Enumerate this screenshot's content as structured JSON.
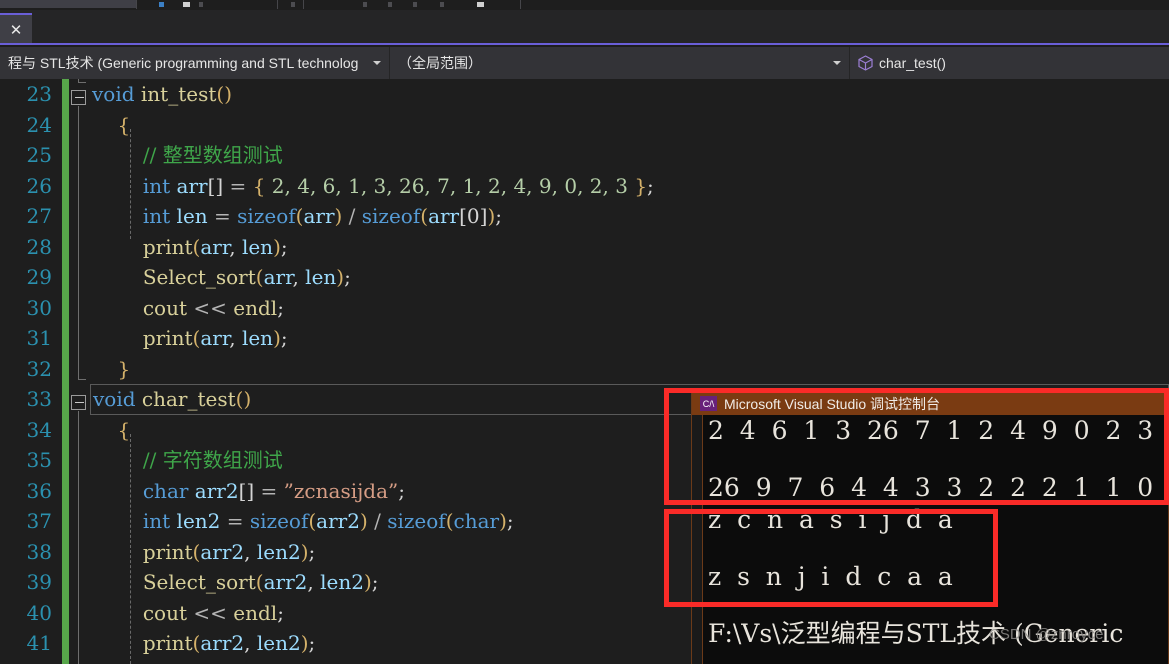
{
  "window": {
    "tab": {
      "close_label": "✕"
    }
  },
  "nav": {
    "project": "程与 STL技术  (Generic programming and STL technolog",
    "scope": "（全局范围）",
    "member": "char_test()",
    "member_icon": "cube-icon",
    "caret_icon": "chevron-down-icon"
  },
  "editor": {
    "line_numbers": [
      "23",
      "24",
      "25",
      "26",
      "27",
      "28",
      "29",
      "30",
      "31",
      "32",
      "33",
      "34",
      "35",
      "36",
      "37",
      "38",
      "39",
      "40",
      "41"
    ],
    "lines": [
      {
        "n": "23",
        "tokens": [
          {
            "t": "void",
            "c": "kw"
          },
          {
            "t": " ",
            "c": "punc"
          },
          {
            "t": "int_test",
            "c": "fn"
          },
          {
            "t": "()",
            "c": "brace-y"
          }
        ]
      },
      {
        "n": "24",
        "tokens": [
          {
            "t": "{",
            "c": "brace-y"
          }
        ]
      },
      {
        "n": "25",
        "tokens": [
          {
            "t": "// 整型数组测试",
            "c": "cmt"
          }
        ]
      },
      {
        "n": "26",
        "tokens": [
          {
            "t": "int",
            "c": "kw"
          },
          {
            "t": " ",
            "c": "punc"
          },
          {
            "t": "arr",
            "c": "ident"
          },
          {
            "t": "[]",
            "c": "punc"
          },
          {
            "t": " = ",
            "c": "op"
          },
          {
            "t": "{",
            "c": "brace-y"
          },
          {
            "t": " 2, 4, 6, 1, 3, 26, 7, 1, 2, 4, 9, 0, 2, 3 ",
            "c": "num"
          },
          {
            "t": "}",
            "c": "brace-y"
          },
          {
            "t": ";",
            "c": "punc"
          }
        ]
      },
      {
        "n": "27",
        "tokens": [
          {
            "t": "int",
            "c": "kw"
          },
          {
            "t": " ",
            "c": "punc"
          },
          {
            "t": "len",
            "c": "ident"
          },
          {
            "t": " = ",
            "c": "op"
          },
          {
            "t": "sizeof",
            "c": "kw"
          },
          {
            "t": "(",
            "c": "brace-y"
          },
          {
            "t": "arr",
            "c": "ident"
          },
          {
            "t": ")",
            "c": "brace-y"
          },
          {
            "t": " / ",
            "c": "op"
          },
          {
            "t": "sizeof",
            "c": "kw"
          },
          {
            "t": "(",
            "c": "brace-y"
          },
          {
            "t": "arr",
            "c": "ident"
          },
          {
            "t": "[0]",
            "c": "punc"
          },
          {
            "t": ")",
            "c": "brace-y"
          },
          {
            "t": ";",
            "c": "punc"
          }
        ]
      },
      {
        "n": "28",
        "tokens": [
          {
            "t": "print",
            "c": "fn"
          },
          {
            "t": "(",
            "c": "brace-y"
          },
          {
            "t": "arr",
            "c": "ident"
          },
          {
            "t": ", ",
            "c": "punc"
          },
          {
            "t": "len",
            "c": "ident"
          },
          {
            "t": ")",
            "c": "brace-y"
          },
          {
            "t": ";",
            "c": "punc"
          }
        ]
      },
      {
        "n": "29",
        "tokens": [
          {
            "t": "Select_sort",
            "c": "fn"
          },
          {
            "t": "(",
            "c": "brace-y"
          },
          {
            "t": "arr",
            "c": "ident"
          },
          {
            "t": ", ",
            "c": "punc"
          },
          {
            "t": "len",
            "c": "ident"
          },
          {
            "t": ")",
            "c": "brace-y"
          },
          {
            "t": ";",
            "c": "punc"
          }
        ]
      },
      {
        "n": "30",
        "tokens": [
          {
            "t": "cout",
            "c": "fn"
          },
          {
            "t": " << ",
            "c": "op"
          },
          {
            "t": "endl",
            "c": "fn"
          },
          {
            "t": ";",
            "c": "punc"
          }
        ]
      },
      {
        "n": "31",
        "tokens": [
          {
            "t": "print",
            "c": "fn"
          },
          {
            "t": "(",
            "c": "brace-y"
          },
          {
            "t": "arr",
            "c": "ident"
          },
          {
            "t": ", ",
            "c": "punc"
          },
          {
            "t": "len",
            "c": "ident"
          },
          {
            "t": ")",
            "c": "brace-y"
          },
          {
            "t": ";",
            "c": "punc"
          }
        ]
      },
      {
        "n": "32",
        "tokens": [
          {
            "t": "}",
            "c": "brace-y"
          }
        ]
      },
      {
        "n": "33",
        "tokens": [
          {
            "t": "void",
            "c": "kw"
          },
          {
            "t": " ",
            "c": "punc"
          },
          {
            "t": "char_test",
            "c": "fn"
          },
          {
            "t": "()",
            "c": "brace-y"
          }
        ]
      },
      {
        "n": "34",
        "tokens": [
          {
            "t": "{",
            "c": "brace-y"
          }
        ]
      },
      {
        "n": "35",
        "tokens": [
          {
            "t": "// 字符数组测试",
            "c": "cmt"
          }
        ]
      },
      {
        "n": "36",
        "tokens": [
          {
            "t": "char",
            "c": "kw"
          },
          {
            "t": " ",
            "c": "punc"
          },
          {
            "t": "arr2",
            "c": "ident"
          },
          {
            "t": "[]",
            "c": "punc"
          },
          {
            "t": " = ",
            "c": "op"
          },
          {
            "t": "”zcnasijda”",
            "c": "str"
          },
          {
            "t": ";",
            "c": "punc"
          }
        ]
      },
      {
        "n": "37",
        "tokens": [
          {
            "t": "int",
            "c": "kw"
          },
          {
            "t": " ",
            "c": "punc"
          },
          {
            "t": "len2",
            "c": "ident"
          },
          {
            "t": " = ",
            "c": "op"
          },
          {
            "t": "sizeof",
            "c": "kw"
          },
          {
            "t": "(",
            "c": "brace-y"
          },
          {
            "t": "arr2",
            "c": "ident"
          },
          {
            "t": ")",
            "c": "brace-y"
          },
          {
            "t": " / ",
            "c": "op"
          },
          {
            "t": "sizeof",
            "c": "kw"
          },
          {
            "t": "(",
            "c": "brace-y"
          },
          {
            "t": "char",
            "c": "kw"
          },
          {
            "t": ")",
            "c": "brace-y"
          },
          {
            "t": ";",
            "c": "punc"
          }
        ]
      },
      {
        "n": "38",
        "tokens": [
          {
            "t": "print",
            "c": "fn"
          },
          {
            "t": "(",
            "c": "brace-y"
          },
          {
            "t": "arr2",
            "c": "ident"
          },
          {
            "t": ", ",
            "c": "punc"
          },
          {
            "t": "len2",
            "c": "ident"
          },
          {
            "t": ")",
            "c": "brace-y"
          },
          {
            "t": ";",
            "c": "punc"
          }
        ]
      },
      {
        "n": "39",
        "tokens": [
          {
            "t": "Select_sort",
            "c": "fn"
          },
          {
            "t": "(",
            "c": "brace-y"
          },
          {
            "t": "arr2",
            "c": "ident"
          },
          {
            "t": ", ",
            "c": "punc"
          },
          {
            "t": "len2",
            "c": "ident"
          },
          {
            "t": ")",
            "c": "brace-y"
          },
          {
            "t": ";",
            "c": "punc"
          }
        ]
      },
      {
        "n": "40",
        "tokens": [
          {
            "t": "cout",
            "c": "fn"
          },
          {
            "t": " << ",
            "c": "op"
          },
          {
            "t": "endl",
            "c": "fn"
          },
          {
            "t": ";",
            "c": "punc"
          }
        ]
      },
      {
        "n": "41",
        "tokens": [
          {
            "t": "print",
            "c": "fn"
          },
          {
            "t": "(",
            "c": "brace-y"
          },
          {
            "t": "arr2",
            "c": "ident"
          },
          {
            "t": ", ",
            "c": "punc"
          },
          {
            "t": "len2",
            "c": "ident"
          },
          {
            "t": ")",
            "c": "brace-y"
          },
          {
            "t": ";",
            "c": "punc"
          }
        ]
      }
    ],
    "current_line": "33"
  },
  "console": {
    "title": "Microsoft Visual Studio 调试控制台",
    "badge": "C/\\",
    "lines": [
      "2  4  6  1  3  26  7  1  2  4  9  0  2  3",
      "",
      "26  9  7  6  4  4  3  3  2  2  2  1  1  0",
      "z  c  n  a  s  i  j  d  a",
      "",
      "z  s  n  j  i  d  c  a  a",
      "",
      "F:\\Vs\\泛型编程与STL技术 (Generic"
    ]
  },
  "annotations": {
    "box_numbers_label": "red-highlight-numbers",
    "box_chars_label": "red-highlight-chars",
    "accent_red": "#fa2b28"
  },
  "watermark": {
    "text": "CSDN @znroyce"
  }
}
